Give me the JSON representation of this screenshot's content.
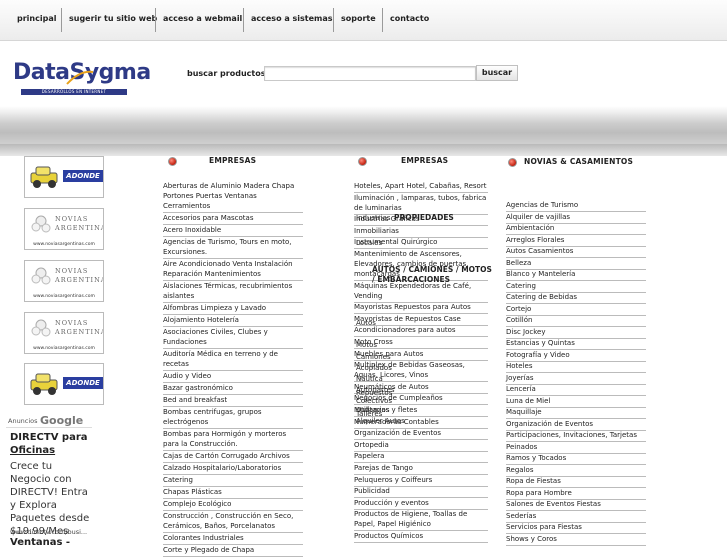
{
  "nav": [
    {
      "label": "principal"
    },
    {
      "label": "sugerir tu sitio web"
    },
    {
      "label": "acceso a webmail"
    },
    {
      "label": "acceso a sistemas"
    },
    {
      "label": "soporte"
    },
    {
      "label": "contacto"
    }
  ],
  "logo": {
    "name": "DataSygma",
    "tagline": "DESARROLLOS EN INTERNET"
  },
  "search": {
    "label": "buscar productos",
    "value": "",
    "button": "buscar"
  },
  "ads": [
    {
      "type": "adonde",
      "text": "ADONDE"
    },
    {
      "type": "novias",
      "line1": "NOVIAS",
      "line2": "ARGENTINAS",
      "caption": "www.noviasargentinas.com"
    },
    {
      "type": "novias",
      "line1": "NOVIAS",
      "line2": "ARGENTINAS",
      "caption": "www.noviasargentinas.com"
    },
    {
      "type": "novias",
      "line1": "NOVIAS",
      "line2": "ARGENTINAS",
      "caption": "www.noviasargentinas.com"
    },
    {
      "type": "adonde",
      "text": "ADONDE"
    }
  ],
  "google_ad": {
    "header": "Anuncios",
    "brand": "Google",
    "title_line1": "DIRECTV para",
    "title_line2": "Oficinas",
    "body": "Crece tu Negocio con DIRECTV! Entra y Explora Paquetes desde $19.99/Mes",
    "url": "www.directv.com/busi...",
    "next": "Ventanas -"
  },
  "col1": {
    "header": "EMPRESAS",
    "items": [
      {
        "label": "Aberturas de Aluminio Madera Chapa Portones Puertas Ventanas Cerramientos"
      },
      {
        "label": "Accesorios para Mascotas"
      },
      {
        "label": "Acero Inoxidable"
      },
      {
        "label": "Agencias de Turismo, Tours en moto, Excursiones."
      },
      {
        "label": "Aire Acondicionado Venta Instalación Reparación Mantenimientos"
      },
      {
        "label": "Aislaciones Térmicas, recubrimientos aislantes"
      },
      {
        "label": "Alfombras Limpieza y Lavado"
      },
      {
        "label": "Alojamiento Hotelería"
      },
      {
        "label": "Asociaciones Civiles, Clubes y Fundaciones"
      },
      {
        "label": "Auditoría Médica en terreno y de recetas"
      },
      {
        "label": "Audio y Video"
      },
      {
        "label": "Bazar gastronómico"
      },
      {
        "label": "Bed and breakfast"
      },
      {
        "label": "Bombas centrifugas, grupos electrógenos"
      },
      {
        "label": "Bombas para Hormigón y morteros para la Construcción."
      },
      {
        "label": "Cajas de Cartón Corrugado Archivos"
      },
      {
        "label": "Calzado Hospitalario/Laboratorios"
      },
      {
        "label": "Catering"
      },
      {
        "label": "Chapas Plásticas"
      },
      {
        "label": "Complejo Ecológico"
      },
      {
        "label": "Construcción , Construcción en Seco, Cerámicos, Baños, Porcelanatos"
      },
      {
        "label": "Colorantes Industriales"
      },
      {
        "label": "Corte y Plegado de Chapa"
      }
    ]
  },
  "col2": {
    "header": "EMPRESAS",
    "items": [
      {
        "label": "Hoteles, Apart Hotel, Cabañas, Resort"
      },
      {
        "label": "Iluminación , lamparas, tubos, fabrica de luminarias"
      },
      {
        "label": "Industrias Gráficas"
      },
      {
        "label": "Inmobiliarias"
      },
      {
        "label": "Instrumental Quirúrgico"
      },
      {
        "label": "Mantenimiento de Ascensores, Elevadores, cambios de puertas, montacargas"
      },
      {
        "label": "Máquinas Expendedoras de Café, Vending"
      },
      {
        "label": "Mayoristas Repuestos para Autos"
      },
      {
        "label": "Mayoristas de Repuestos Case"
      },
      {
        "label": "Acondicionadores para autos"
      },
      {
        "label": "Moto Cross"
      },
      {
        "label": "Muebles para Autos"
      },
      {
        "label": "Multiplex de Bebidas Gaseosas, Aguas, Licores, Vinos"
      },
      {
        "label": "Neumáticos de Autos"
      },
      {
        "label": "Negocios de Cumpleaños"
      },
      {
        "label": "Mudanzas y fletes"
      },
      {
        "label": "Numeradoras Contables"
      },
      {
        "label": "Organización de Eventos"
      },
      {
        "label": "Ortopedia"
      },
      {
        "label": "Papelera"
      },
      {
        "label": "Parejas de Tango"
      },
      {
        "label": "Peluqueros y Coiffeurs"
      },
      {
        "label": "Publicidad"
      },
      {
        "label": "Producción y eventos"
      },
      {
        "label": "Productos de Higiene, Toallas de Papel, Papel Higiénico"
      },
      {
        "label": "Productos Químicos"
      }
    ],
    "overlay_headers": [
      {
        "label": "PROPIEDADES"
      },
      {
        "label": "AUTOS / CAMIONES / MOTOS / EMBARCACIONES"
      }
    ],
    "overlay_items": [
      {
        "label": "Industrias"
      },
      {
        "label": "Locales"
      },
      {
        "label": "Autos"
      },
      {
        "label": "Motos"
      },
      {
        "label": "Camiones"
      },
      {
        "label": "Acoplados"
      },
      {
        "label": "Náutica"
      },
      {
        "label": "Autopartes"
      },
      {
        "label": "Colectivos"
      },
      {
        "label": "Utilitarios"
      },
      {
        "label": "Alquiler Autos"
      },
      {
        "label": "Repuestos"
      },
      {
        "label": "Talleres"
      }
    ]
  },
  "col3": {
    "header": "NOVIAS & CASAMIENTOS",
    "items": [
      {
        "label": "Agencias de Turismo"
      },
      {
        "label": "Alquiler de vajillas"
      },
      {
        "label": "Ambientación"
      },
      {
        "label": "Arreglos Florales"
      },
      {
        "label": "Autos Casamientos"
      },
      {
        "label": "Belleza"
      },
      {
        "label": "Blanco y Mantelería"
      },
      {
        "label": "Catering"
      },
      {
        "label": "Catering de Bebidas"
      },
      {
        "label": "Cortejo"
      },
      {
        "label": "Cotillón"
      },
      {
        "label": "Disc Jockey"
      },
      {
        "label": "Estancias y Quintas"
      },
      {
        "label": "Fotografía y Video"
      },
      {
        "label": "Hoteles"
      },
      {
        "label": "Joyerías"
      },
      {
        "label": "Lencería"
      },
      {
        "label": "Luna de Miel"
      },
      {
        "label": "Maquillaje"
      },
      {
        "label": "Organización de Eventos"
      },
      {
        "label": "Participaciones, Invitaciones, Tarjetas"
      },
      {
        "label": "Peinados"
      },
      {
        "label": "Ramos y Tocados"
      },
      {
        "label": "Regalos"
      },
      {
        "label": "Ropa de Fiestas"
      },
      {
        "label": "Ropa para Hombre"
      },
      {
        "label": "Salones de Eventos Fiestas"
      },
      {
        "label": "Sederías"
      },
      {
        "label": "Servicios para Fiestas"
      },
      {
        "label": "Shows y Coros"
      }
    ]
  }
}
